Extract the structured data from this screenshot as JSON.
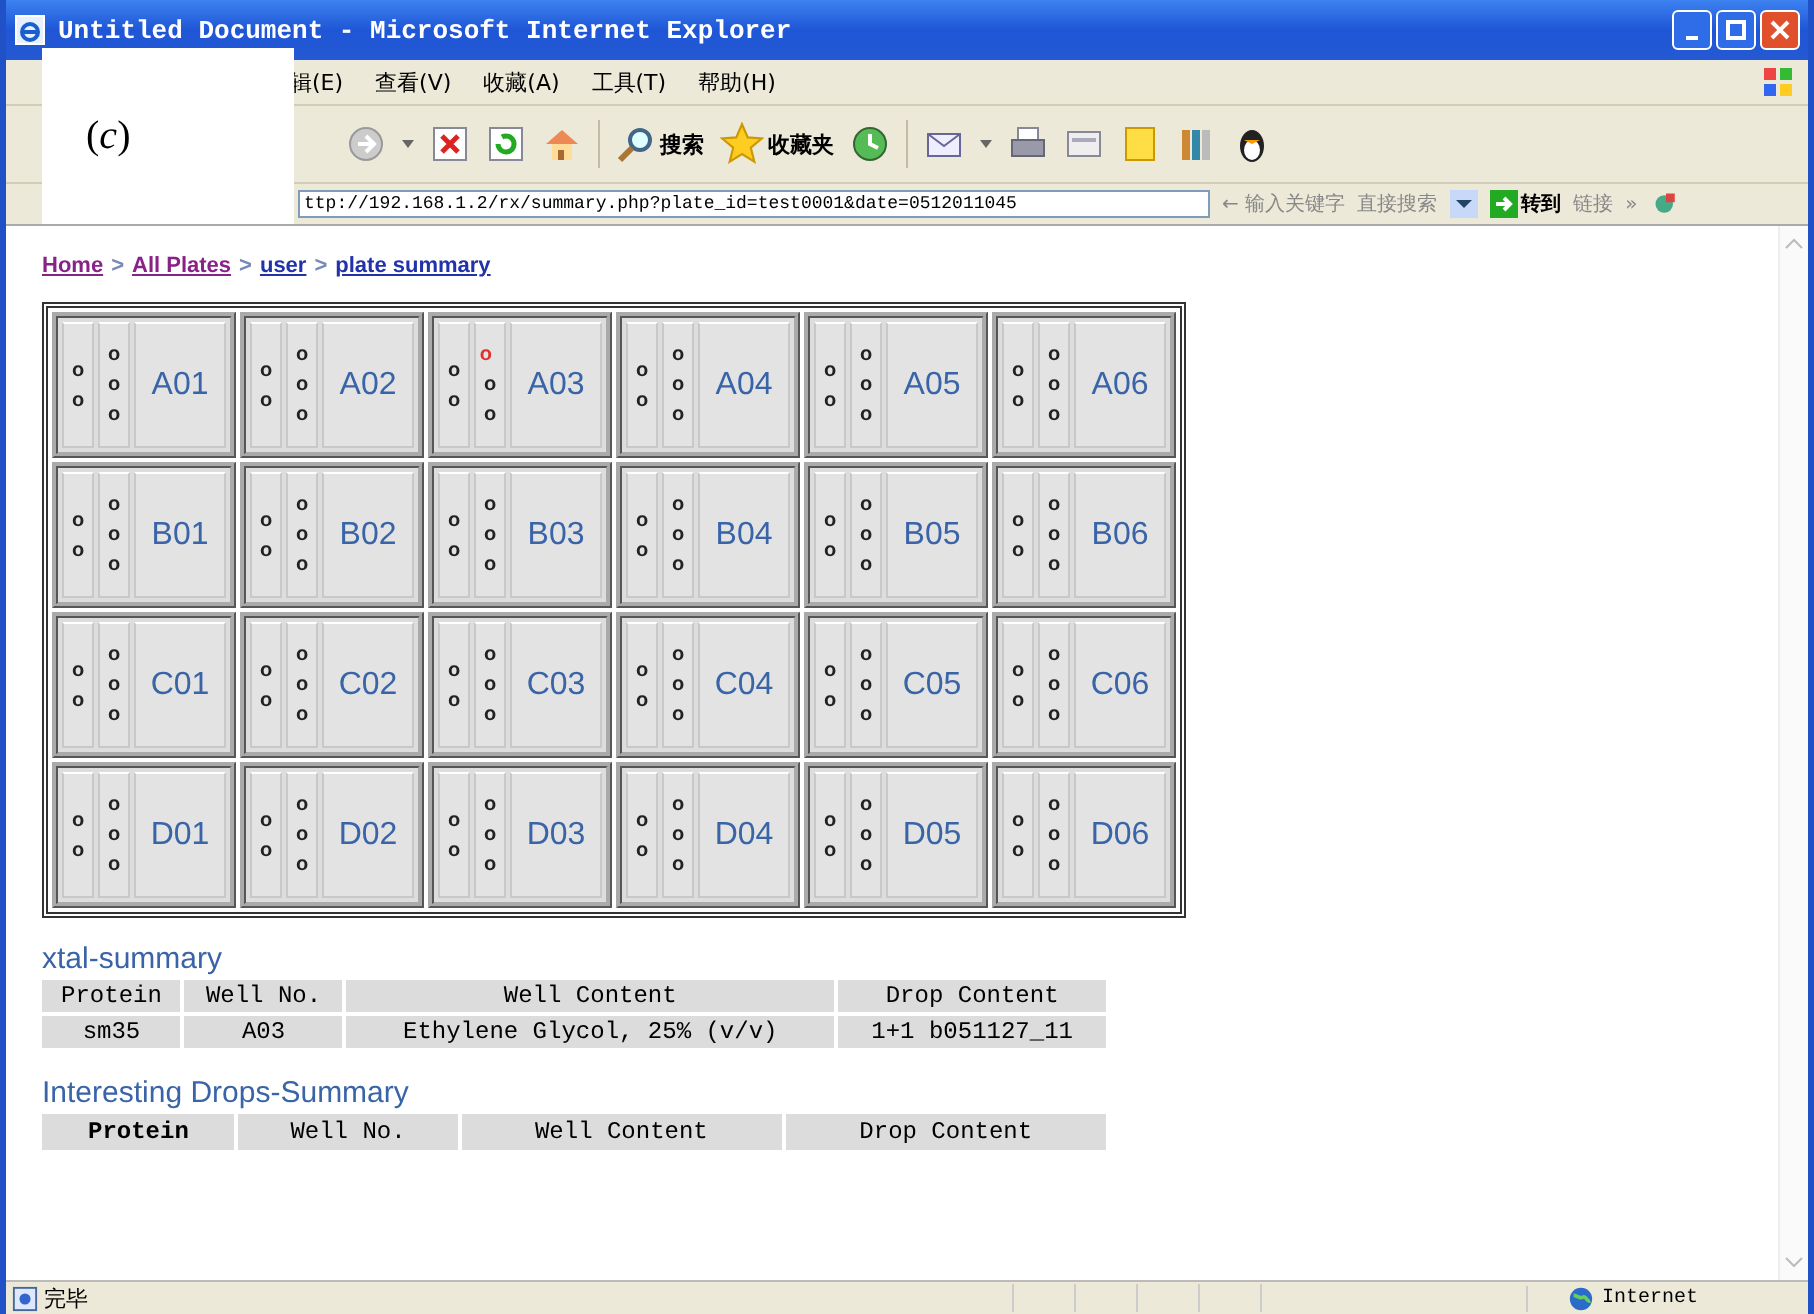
{
  "window": {
    "title": "Untitled Document - Microsoft Internet Explorer"
  },
  "figure_label": "(*c*)",
  "menu": [
    "辑(E)",
    "查看(V)",
    "收藏(A)",
    "工具(T)",
    "帮助(H)"
  ],
  "toolbar": {
    "search_label": "搜索",
    "favorites_label": "收藏夹"
  },
  "address_bar": {
    "value": "ttp://192.168.1.2/rx/summary.php?plate_id=test0001&date=0512011045",
    "search_hint": "← 输入关键字",
    "search_button": "直接搜索",
    "go": "转到",
    "links": "链接",
    "links_more": "»"
  },
  "breadcrumb": [
    {
      "kind": "link",
      "label": "Home",
      "visited": true
    },
    {
      "kind": "sep",
      "label": ">"
    },
    {
      "kind": "link",
      "label": "All Plates",
      "visited": true
    },
    {
      "kind": "sep",
      "label": ">"
    },
    {
      "kind": "link",
      "label": "user",
      "visited": false
    },
    {
      "kind": "sep",
      "label": ">"
    },
    {
      "kind": "link",
      "label": "plate summary",
      "visited": false
    }
  ],
  "plate": {
    "rows": [
      {
        "wells": [
          {
            "label": "A01",
            "left": [
              {
                "text": "o",
                "flagged": false
              },
              {
                "text": "o",
                "flagged": false
              }
            ],
            "middle": [
              {
                "text": "o",
                "flagged": false
              },
              {
                "text": "o",
                "flagged": false
              },
              {
                "text": "o",
                "flagged": false
              }
            ]
          },
          {
            "label": "A02",
            "left": [
              {
                "text": "o",
                "flagged": false
              },
              {
                "text": "o",
                "flagged": false
              }
            ],
            "middle": [
              {
                "text": "o",
                "flagged": false
              },
              {
                "text": "o",
                "flagged": false
              },
              {
                "text": "o",
                "flagged": false
              }
            ]
          },
          {
            "label": "A03",
            "left": [
              {
                "text": "o",
                "flagged": false
              },
              {
                "text": "o",
                "flagged": false
              }
            ],
            "middle": [
              {
                "text": "o",
                "flagged": true
              },
              {
                "text": "o",
                "flagged": false
              },
              {
                "text": "o",
                "flagged": false
              }
            ]
          },
          {
            "label": "A04",
            "left": [
              {
                "text": "o",
                "flagged": false
              },
              {
                "text": "o",
                "flagged": false
              }
            ],
            "middle": [
              {
                "text": "o",
                "flagged": false
              },
              {
                "text": "o",
                "flagged": false
              },
              {
                "text": "o",
                "flagged": false
              }
            ]
          },
          {
            "label": "A05",
            "left": [
              {
                "text": "o",
                "flagged": false
              },
              {
                "text": "o",
                "flagged": false
              }
            ],
            "middle": [
              {
                "text": "o",
                "flagged": false
              },
              {
                "text": "o",
                "flagged": false
              },
              {
                "text": "o",
                "flagged": false
              }
            ]
          },
          {
            "label": "A06",
            "left": [
              {
                "text": "o",
                "flagged": false
              },
              {
                "text": "o",
                "flagged": false
              }
            ],
            "middle": [
              {
                "text": "o",
                "flagged": false
              },
              {
                "text": "o",
                "flagged": false
              },
              {
                "text": "o",
                "flagged": false
              }
            ]
          }
        ]
      },
      {
        "wells": [
          {
            "label": "B01",
            "left": [
              {
                "text": "o",
                "flagged": false
              },
              {
                "text": "o",
                "flagged": false
              }
            ],
            "middle": [
              {
                "text": "o",
                "flagged": false
              },
              {
                "text": "o",
                "flagged": false
              },
              {
                "text": "o",
                "flagged": false
              }
            ]
          },
          {
            "label": "B02",
            "left": [
              {
                "text": "o",
                "flagged": false
              },
              {
                "text": "o",
                "flagged": false
              }
            ],
            "middle": [
              {
                "text": "o",
                "flagged": false
              },
              {
                "text": "o",
                "flagged": false
              },
              {
                "text": "o",
                "flagged": false
              }
            ]
          },
          {
            "label": "B03",
            "left": [
              {
                "text": "o",
                "flagged": false
              },
              {
                "text": "o",
                "flagged": false
              }
            ],
            "middle": [
              {
                "text": "o",
                "flagged": false
              },
              {
                "text": "o",
                "flagged": false
              },
              {
                "text": "o",
                "flagged": false
              }
            ]
          },
          {
            "label": "B04",
            "left": [
              {
                "text": "o",
                "flagged": false
              },
              {
                "text": "o",
                "flagged": false
              }
            ],
            "middle": [
              {
                "text": "o",
                "flagged": false
              },
              {
                "text": "o",
                "flagged": false
              },
              {
                "text": "o",
                "flagged": false
              }
            ]
          },
          {
            "label": "B05",
            "left": [
              {
                "text": "o",
                "flagged": false
              },
              {
                "text": "o",
                "flagged": false
              }
            ],
            "middle": [
              {
                "text": "o",
                "flagged": false
              },
              {
                "text": "o",
                "flagged": false
              },
              {
                "text": "o",
                "flagged": false
              }
            ]
          },
          {
            "label": "B06",
            "left": [
              {
                "text": "o",
                "flagged": false
              },
              {
                "text": "o",
                "flagged": false
              }
            ],
            "middle": [
              {
                "text": "o",
                "flagged": false
              },
              {
                "text": "o",
                "flagged": false
              },
              {
                "text": "o",
                "flagged": false
              }
            ]
          }
        ]
      },
      {
        "wells": [
          {
            "label": "C01",
            "left": [
              {
                "text": "o",
                "flagged": false
              },
              {
                "text": "o",
                "flagged": false
              }
            ],
            "middle": [
              {
                "text": "o",
                "flagged": false
              },
              {
                "text": "o",
                "flagged": false
              },
              {
                "text": "o",
                "flagged": false
              }
            ]
          },
          {
            "label": "C02",
            "left": [
              {
                "text": "o",
                "flagged": false
              },
              {
                "text": "o",
                "flagged": false
              }
            ],
            "middle": [
              {
                "text": "o",
                "flagged": false
              },
              {
                "text": "o",
                "flagged": false
              },
              {
                "text": "o",
                "flagged": false
              }
            ]
          },
          {
            "label": "C03",
            "left": [
              {
                "text": "o",
                "flagged": false
              },
              {
                "text": "o",
                "flagged": false
              }
            ],
            "middle": [
              {
                "text": "o",
                "flagged": false
              },
              {
                "text": "o",
                "flagged": false
              },
              {
                "text": "o",
                "flagged": false
              }
            ]
          },
          {
            "label": "C04",
            "left": [
              {
                "text": "o",
                "flagged": false
              },
              {
                "text": "o",
                "flagged": false
              }
            ],
            "middle": [
              {
                "text": "o",
                "flagged": false
              },
              {
                "text": "o",
                "flagged": false
              },
              {
                "text": "o",
                "flagged": false
              }
            ]
          },
          {
            "label": "C05",
            "left": [
              {
                "text": "o",
                "flagged": false
              },
              {
                "text": "o",
                "flagged": false
              }
            ],
            "middle": [
              {
                "text": "o",
                "flagged": false
              },
              {
                "text": "o",
                "flagged": false
              },
              {
                "text": "o",
                "flagged": false
              }
            ]
          },
          {
            "label": "C06",
            "left": [
              {
                "text": "o",
                "flagged": false
              },
              {
                "text": "o",
                "flagged": false
              }
            ],
            "middle": [
              {
                "text": "o",
                "flagged": false
              },
              {
                "text": "o",
                "flagged": false
              },
              {
                "text": "o",
                "flagged": false
              }
            ]
          }
        ]
      },
      {
        "wells": [
          {
            "label": "D01",
            "left": [
              {
                "text": "o",
                "flagged": false
              },
              {
                "text": "o",
                "flagged": false
              }
            ],
            "middle": [
              {
                "text": "o",
                "flagged": false
              },
              {
                "text": "o",
                "flagged": false
              },
              {
                "text": "o",
                "flagged": false
              }
            ]
          },
          {
            "label": "D02",
            "left": [
              {
                "text": "o",
                "flagged": false
              },
              {
                "text": "o",
                "flagged": false
              }
            ],
            "middle": [
              {
                "text": "o",
                "flagged": false
              },
              {
                "text": "o",
                "flagged": false
              },
              {
                "text": "o",
                "flagged": false
              }
            ]
          },
          {
            "label": "D03",
            "left": [
              {
                "text": "o",
                "flagged": false
              },
              {
                "text": "o",
                "flagged": false
              }
            ],
            "middle": [
              {
                "text": "o",
                "flagged": false
              },
              {
                "text": "o",
                "flagged": false
              },
              {
                "text": "o",
                "flagged": false
              }
            ]
          },
          {
            "label": "D04",
            "left": [
              {
                "text": "o",
                "flagged": false
              },
              {
                "text": "o",
                "flagged": false
              }
            ],
            "middle": [
              {
                "text": "o",
                "flagged": false
              },
              {
                "text": "o",
                "flagged": false
              },
              {
                "text": "o",
                "flagged": false
              }
            ]
          },
          {
            "label": "D05",
            "left": [
              {
                "text": "o",
                "flagged": false
              },
              {
                "text": "o",
                "flagged": false
              }
            ],
            "middle": [
              {
                "text": "o",
                "flagged": false
              },
              {
                "text": "o",
                "flagged": false
              },
              {
                "text": "o",
                "flagged": false
              }
            ]
          },
          {
            "label": "D06",
            "left": [
              {
                "text": "o",
                "flagged": false
              },
              {
                "text": "o",
                "flagged": false
              }
            ],
            "middle": [
              {
                "text": "o",
                "flagged": false
              },
              {
                "text": "o",
                "flagged": false
              },
              {
                "text": "o",
                "flagged": false
              }
            ]
          }
        ]
      }
    ]
  },
  "xtal_summary": {
    "title": "xtal-summary",
    "columns": [
      {
        "label": "Protein",
        "bold": false
      },
      {
        "label": "Well No.",
        "bold": false
      },
      {
        "label": "Well Content",
        "bold": false
      },
      {
        "label": "Drop Content",
        "bold": false
      }
    ],
    "rows": [
      [
        "sm35",
        "A03",
        "Ethylene Glycol, 25% (v/v)",
        "1+1 b051127_11"
      ]
    ]
  },
  "interesting_summary": {
    "title": "Interesting Drops-Summary",
    "columns": [
      {
        "label": "Protein",
        "bold": true
      },
      {
        "label": "Well No.",
        "bold": false
      },
      {
        "label": "Well Content",
        "bold": false
      },
      {
        "label": "Drop Content",
        "bold": false
      }
    ]
  },
  "status_bar": {
    "text": "完毕",
    "zone": "Internet"
  }
}
